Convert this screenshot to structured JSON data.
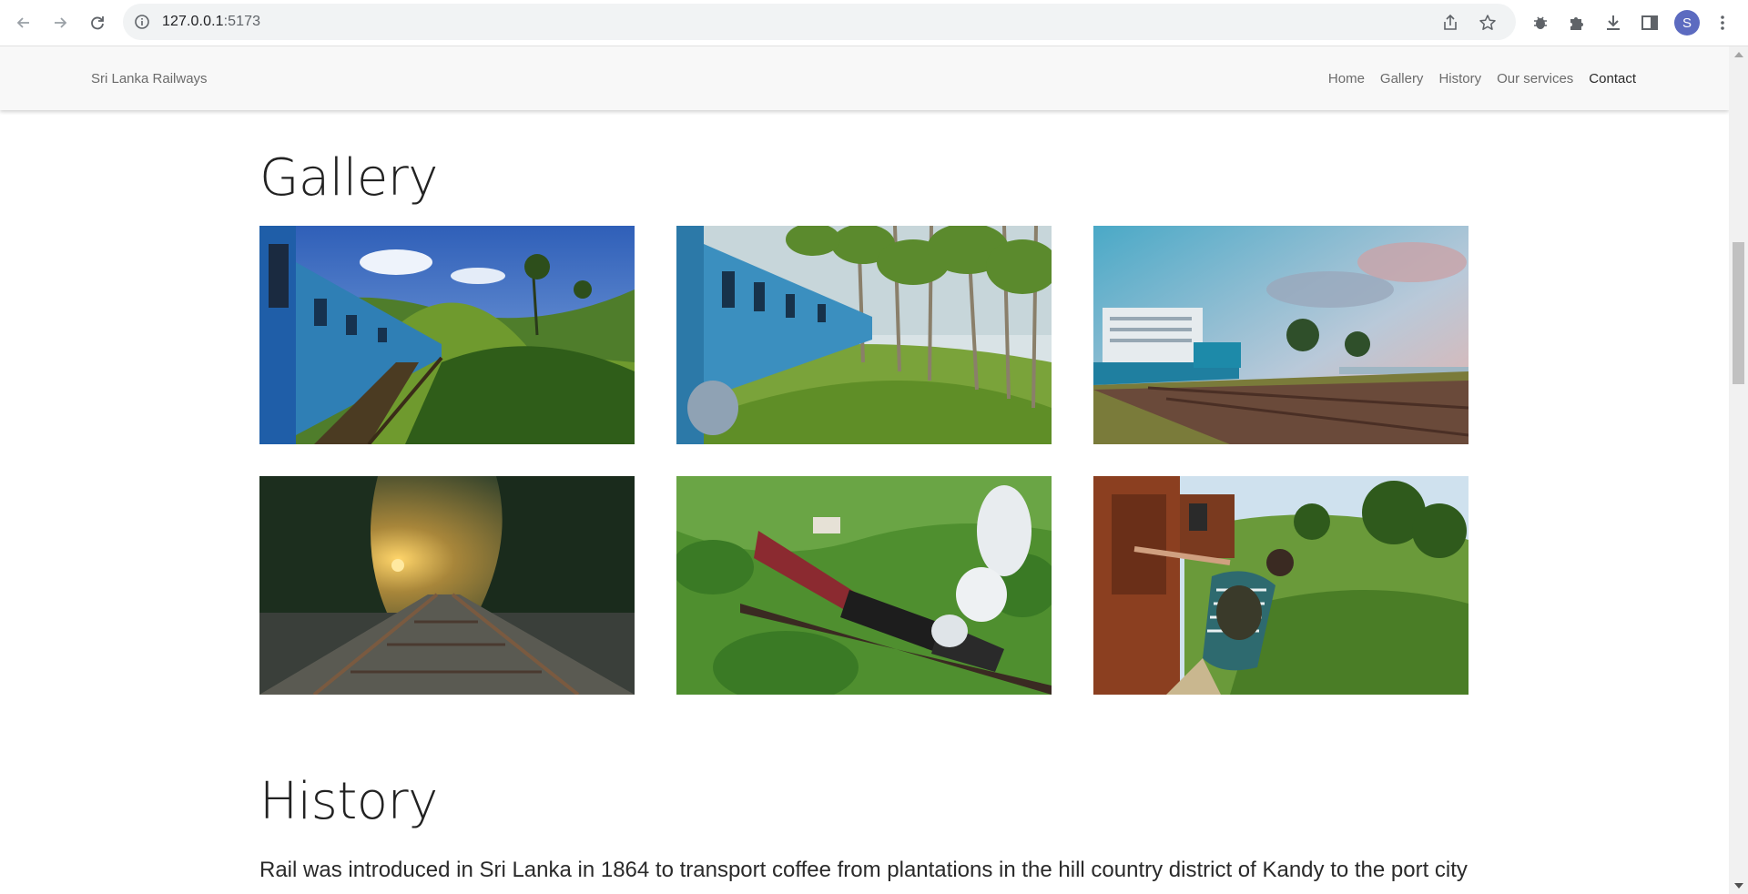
{
  "browser": {
    "url_host": "127.0.0.1",
    "url_port": ":5173",
    "avatar_letter": "S",
    "icons": [
      "back-icon",
      "forward-icon",
      "reload-icon",
      "site-info-icon",
      "share-icon",
      "bookmark-star-icon",
      "bug-extension-icon",
      "puzzle-extensions-icon",
      "download-icon",
      "side-panel-icon",
      "more-menu-icon"
    ]
  },
  "site": {
    "brand": "Sri Lanka Railways",
    "nav": [
      {
        "label": "Home"
      },
      {
        "label": "Gallery"
      },
      {
        "label": "History"
      },
      {
        "label": "Our services"
      },
      {
        "label": "Contact"
      }
    ],
    "active_nav": "Contact"
  },
  "gallery": {
    "title": "Gallery",
    "images": [
      {
        "subject": "blue train on hillside curve"
      },
      {
        "subject": "blue train through eucalyptus forest"
      },
      {
        "subject": "blue train by coastal hotel"
      },
      {
        "subject": "railway track at sunset in jungle"
      },
      {
        "subject": "steam locomotive on bridge in tea fields"
      },
      {
        "subject": "traveller photographing from train door"
      }
    ]
  },
  "history": {
    "title": "History",
    "text": "Rail was introduced in Sri Lanka in 1864 to transport coffee from plantations in the hill country district of Kandy to the port city"
  },
  "colors": {
    "navbar_bg": "#f8f8f8",
    "train_blue": "#2f7fb5",
    "avatar": "#5c6bc0"
  }
}
